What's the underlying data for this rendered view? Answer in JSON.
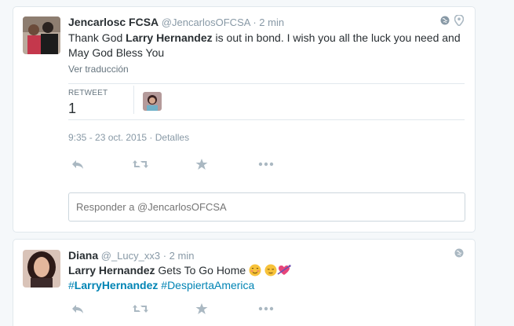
{
  "tweets": [
    {
      "fullname": "Jencarlosc FCSA",
      "handle": "@JencarlosOFCSA",
      "time": "· 2 min",
      "text_parts": [
        "Thank God ",
        "Larry Hernandez",
        " is out in bond. I wish you all the luck you need and May God Bless You"
      ],
      "translate_label": "Ver traducción",
      "retweet_label": "RETWEET",
      "retweet_count": "1",
      "timestamp": "9:35 - 23 oct. 2015",
      "details_label": " · Detalles",
      "reply_placeholder": "Responder a @JencarlosOFCSA"
    },
    {
      "fullname": "Diana",
      "handle": "@_Lucy_xx3",
      "time": "· 2 min",
      "text_bold": "Larry Hernandez",
      "text_rest": " Gets To Go Home ",
      "hashtag1_prefix": "#",
      "hashtag1": "LarryHernandez",
      "hashtag2": "#DespiertaAmerica"
    }
  ],
  "icons": [
    "reply-icon",
    "retweet-icon",
    "favorite-icon",
    "more-icon",
    "globe-icon",
    "location-icon"
  ],
  "colors": {
    "link": "#0084b4",
    "muted": "#8899a6",
    "action": "#aab8c2",
    "border": "#e1e8ed"
  }
}
